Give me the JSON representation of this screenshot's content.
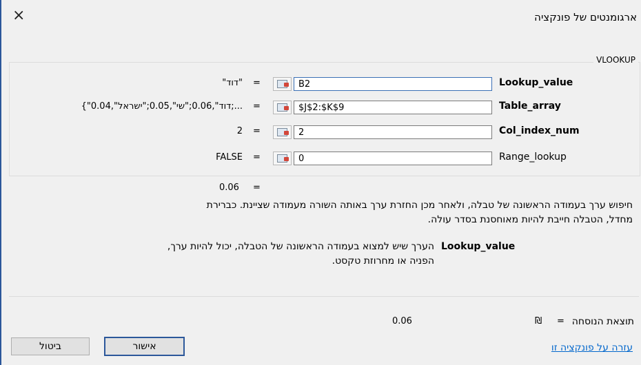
{
  "dialog": {
    "title": "ארגומנטים של פונקציה",
    "close_glyph": "×",
    "function_name": "VLOOKUP"
  },
  "args": [
    {
      "name": "Lookup_value",
      "bold": true,
      "input": "B2",
      "evaluated": "\"דוד\"",
      "eq": "="
    },
    {
      "name": "Table_array",
      "bold": true,
      "input": "$J$2:$K$9",
      "evaluated": "{\"דוד\",0.06;\"שי\",0.05;\"ישראל\",0.04;...",
      "eq": "="
    },
    {
      "name": "Col_index_num",
      "bold": true,
      "input": "2",
      "evaluated": "2",
      "eq": "="
    },
    {
      "name": "Range_lookup",
      "bold": false,
      "input": "0",
      "evaluated": "FALSE",
      "eq": "="
    }
  ],
  "function_result": {
    "value": "0.06",
    "eq": "="
  },
  "description": {
    "line1": "חיפוש ערך בעמודה הראשונה של טבלה, ולאחר מכן החזרת ערך באותה השורה מעמודה שציינת. כברירת",
    "line2": "מחדל, הטבלה חייבת להיות מאוחסנת בסדר עולה."
  },
  "arg_help": {
    "name": "Lookup_value",
    "line1": "הערך שיש למצוא בעמודה הראשונה של הטבלה, יכול להיות ערך,",
    "line2": "הפניה או מחרוזת טקסט."
  },
  "formula_result": {
    "label": "תוצאת הנוסחה",
    "eq": "=",
    "currency": "₪",
    "value": "0.06"
  },
  "help_link": "עזרה על פונקציה זו",
  "buttons": {
    "ok": "אישור",
    "cancel": "ביטול"
  },
  "colors": {
    "accent": "#2b579a",
    "link": "#0066cc",
    "background": "#f0f0f0"
  },
  "icons": [
    "close-icon",
    "cell-reference-icon"
  ]
}
